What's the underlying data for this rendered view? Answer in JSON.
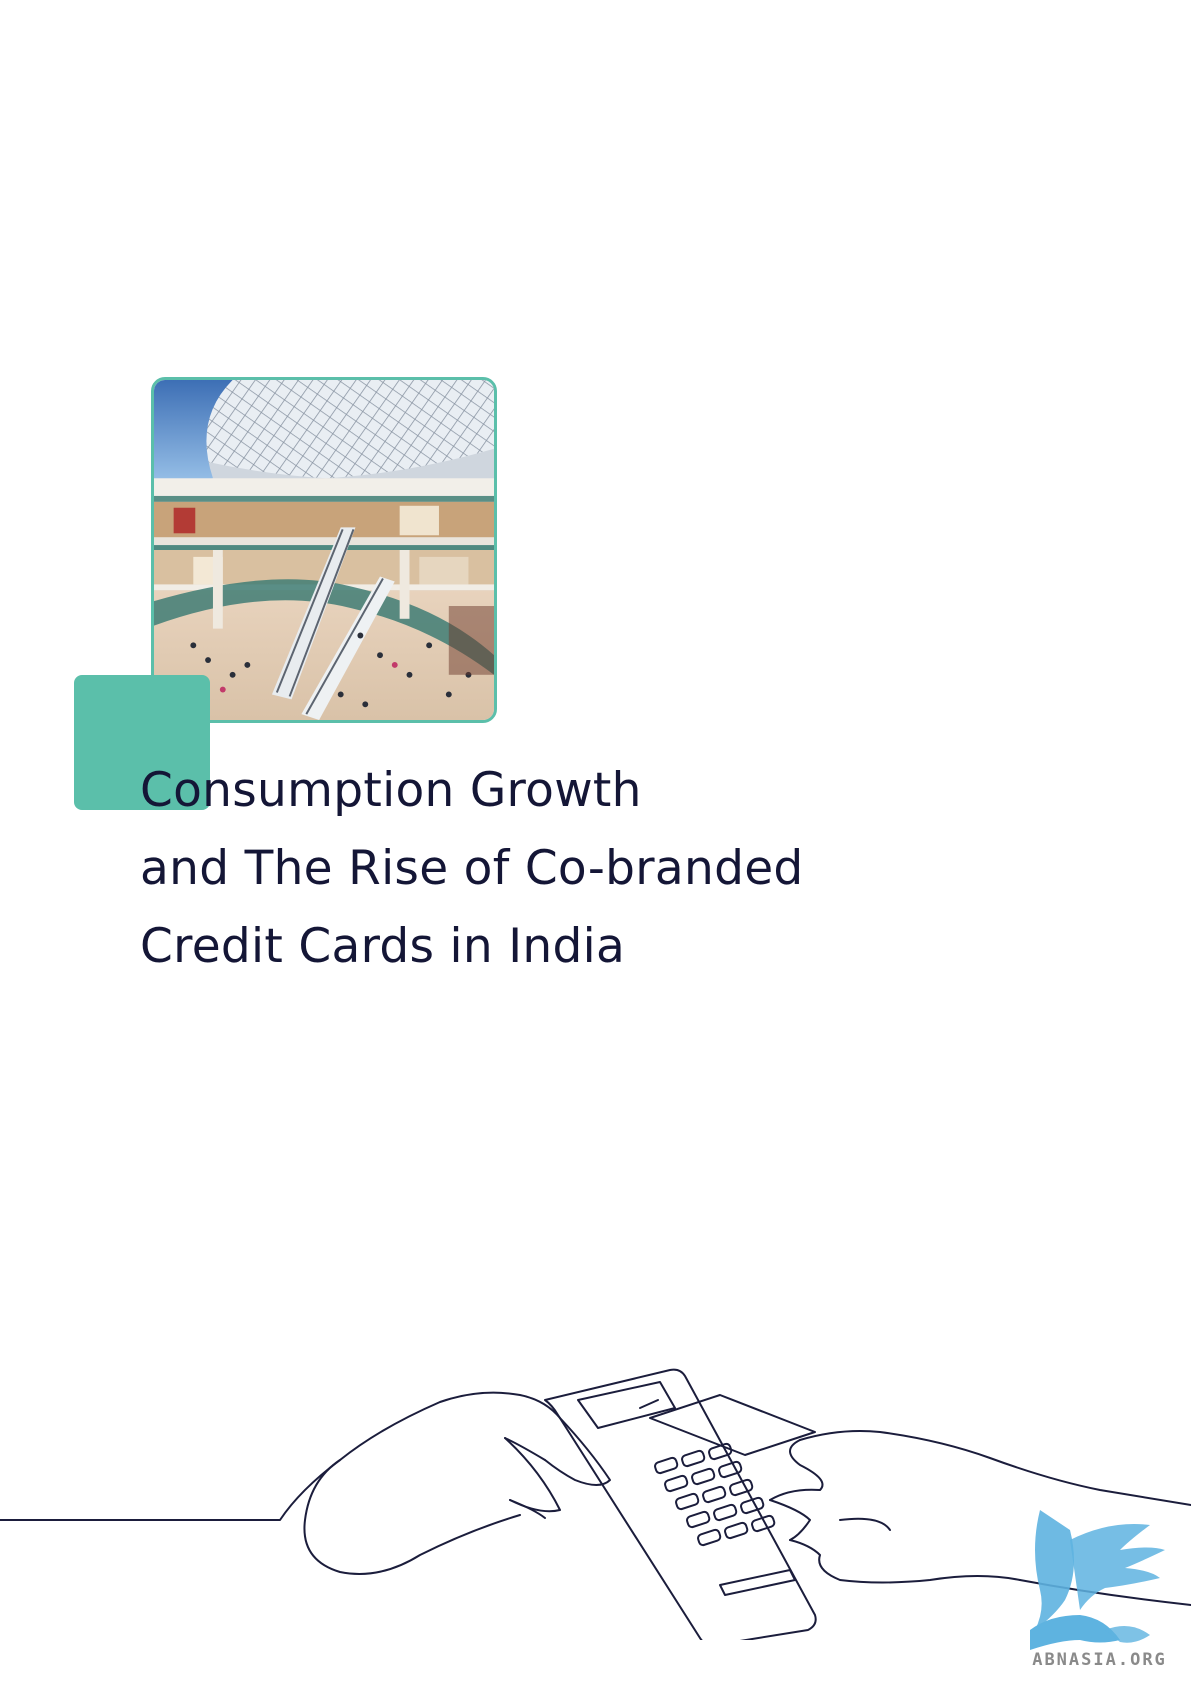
{
  "document": {
    "title_lines": [
      "Consumption Growth",
      "and The Rise of Co-branded",
      "Credit Cards in India"
    ],
    "watermark_text": "ABNASIA.ORG"
  },
  "colors": {
    "accent_teal": "#5bbfaa",
    "title_navy": "#141636",
    "line_art": "#1b1d3c",
    "logo_blue": "#5eb3e0"
  },
  "images": {
    "cover_photo": "shopping-mall-atrium-photo",
    "illustration": "hand-paying-with-card-at-pos-terminal-line-art",
    "logo": "griffin-logo"
  }
}
